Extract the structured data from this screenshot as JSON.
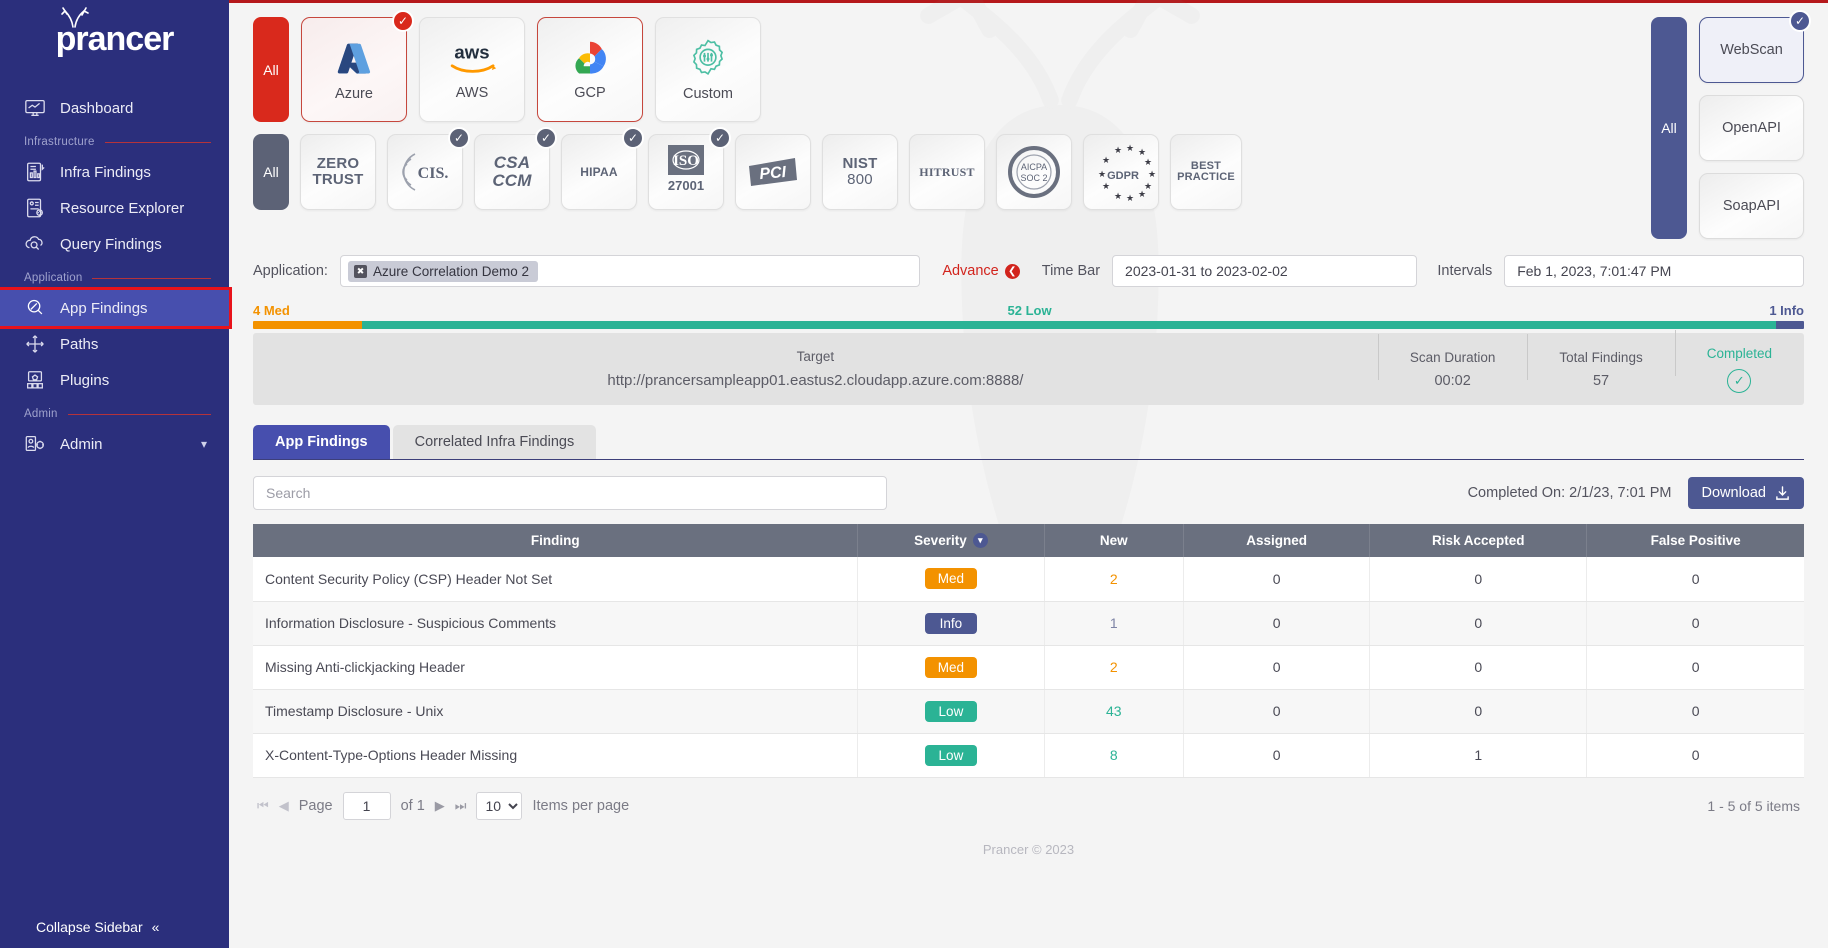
{
  "sidebar": {
    "brand": "prancer",
    "items": [
      {
        "label": "Dashboard",
        "icon": "dashboard-icon",
        "type": "item"
      },
      {
        "label": "Infrastructure",
        "type": "section"
      },
      {
        "label": "Infra Findings",
        "icon": "infra-findings-icon",
        "type": "item"
      },
      {
        "label": "Resource Explorer",
        "icon": "resource-explorer-icon",
        "type": "item"
      },
      {
        "label": "Query Findings",
        "icon": "query-findings-icon",
        "type": "item"
      },
      {
        "label": "Application",
        "type": "section"
      },
      {
        "label": "App Findings",
        "icon": "app-findings-icon",
        "type": "item",
        "active": true
      },
      {
        "label": "Paths",
        "icon": "paths-icon",
        "type": "item"
      },
      {
        "label": "Plugins",
        "icon": "plugins-icon",
        "type": "item"
      },
      {
        "label": "Admin",
        "type": "section"
      },
      {
        "label": "Admin",
        "icon": "admin-icon",
        "type": "item",
        "chevron": "chevron-down-icon"
      }
    ],
    "collapse_label": "Collapse Sidebar",
    "collapse_icon": "double-chevron-left-icon"
  },
  "providers": {
    "all_label": "All",
    "cards": [
      {
        "label": "Azure",
        "icon": "azure-logo",
        "selected": true,
        "checked": true
      },
      {
        "label": "AWS",
        "icon": "aws-logo",
        "selected": false,
        "checked": false
      },
      {
        "label": "GCP",
        "icon": "gcp-logo",
        "selected": true,
        "checked": false
      },
      {
        "label": "Custom",
        "icon": "custom-gear-icon",
        "selected": false,
        "checked": false
      }
    ]
  },
  "standards": {
    "all_label": "All",
    "cards": [
      {
        "label": "ZERO TRUST",
        "icon": "zero-trust-logo",
        "checked": false
      },
      {
        "label": "CIS.",
        "icon": "cis-logo",
        "checked": true
      },
      {
        "label": "CSA CCM",
        "icon": "csa-ccm-logo",
        "checked": true
      },
      {
        "label": "HIPAA",
        "icon": "hipaa-logo",
        "checked": true
      },
      {
        "label": "ISO 27001",
        "icon": "iso-27001-logo",
        "checked": true
      },
      {
        "label": "PCI",
        "icon": "pci-logo",
        "checked": false
      },
      {
        "label": "NIST 800",
        "icon": "nist-800-logo",
        "checked": false
      },
      {
        "label": "HITRUST",
        "icon": "hitrust-logo",
        "checked": false
      },
      {
        "label": "AICPA SOC 2",
        "icon": "aicpa-soc2-logo",
        "checked": false
      },
      {
        "label": "GDPR",
        "icon": "gdpr-logo",
        "checked": false
      },
      {
        "label": "BEST PRACTICE",
        "icon": "best-practice-logo",
        "checked": false
      }
    ]
  },
  "scan_types": {
    "all_label": "All",
    "cards": [
      {
        "label": "WebScan",
        "selected": true,
        "checked": true
      },
      {
        "label": "OpenAPI",
        "selected": false,
        "checked": false
      },
      {
        "label": "SoapAPI",
        "selected": false,
        "checked": false
      }
    ]
  },
  "filters": {
    "application_label": "Application:",
    "application_chip": "Azure Correlation Demo 2",
    "advance_label": "Advance",
    "time_bar_label": "Time Bar",
    "time_bar_value": "2023-01-31 to 2023-02-02",
    "intervals_label": "Intervals",
    "intervals_value": "Feb 1, 2023, 7:01:47 PM"
  },
  "severity_bar": {
    "segments": [
      {
        "label": "4 Med",
        "count": 4,
        "color": "#f39200",
        "percent": 7.0
      },
      {
        "label": "52 Low",
        "count": 52,
        "color": "#2bb395",
        "percent": 91.2
      },
      {
        "label": "1 Info",
        "count": 1,
        "color": "#4d5892",
        "percent": 1.8
      }
    ]
  },
  "summary": {
    "target_label": "Target",
    "target_value": "http://prancersampleapp01.eastus2.cloudapp.azure.com:8888/",
    "scan_duration_label": "Scan Duration",
    "scan_duration_value": "00:02",
    "total_findings_label": "Total Findings",
    "total_findings_value": "57",
    "status_label": "Completed",
    "status_icon": "check-circle-icon"
  },
  "tabs": [
    {
      "label": "App Findings",
      "active": true
    },
    {
      "label": "Correlated Infra Findings",
      "active": false
    }
  ],
  "toolbar": {
    "search_placeholder": "Search",
    "search_value": "",
    "completed_on": "Completed On: 2/1/23, 7:01 PM",
    "download_label": "Download",
    "download_icon": "download-icon"
  },
  "table": {
    "columns": [
      "Finding",
      "Severity",
      "New",
      "Assigned",
      "Risk Accepted",
      "False Positive"
    ],
    "sort_column": "Severity",
    "sort_icon": "chevron-down-icon",
    "rows": [
      {
        "finding": "Content Security Policy (CSP) Header Not Set",
        "severity": "Med",
        "severity_class": "med",
        "new": "2",
        "assigned": "0",
        "risk_accepted": "0",
        "false_positive": "0"
      },
      {
        "finding": "Information Disclosure - Suspicious Comments",
        "severity": "Info",
        "severity_class": "info",
        "new": "1",
        "assigned": "0",
        "risk_accepted": "0",
        "false_positive": "0"
      },
      {
        "finding": "Missing Anti-clickjacking Header",
        "severity": "Med",
        "severity_class": "med",
        "new": "2",
        "assigned": "0",
        "risk_accepted": "0",
        "false_positive": "0"
      },
      {
        "finding": "Timestamp Disclosure - Unix",
        "severity": "Low",
        "severity_class": "low",
        "new": "43",
        "assigned": "0",
        "risk_accepted": "0",
        "false_positive": "0"
      },
      {
        "finding": "X-Content-Type-Options Header Missing",
        "severity": "Low",
        "severity_class": "low",
        "new": "8",
        "assigned": "0",
        "risk_accepted": "1",
        "false_positive": "0"
      }
    ]
  },
  "pagination": {
    "first_icon": "first-page-icon",
    "prev_icon": "prev-page-icon",
    "page_label": "Page",
    "page_value": "1",
    "of_label": "of 1",
    "next_icon": "next-page-icon",
    "last_icon": "last-page-icon",
    "items_per_page_value": "10",
    "items_per_page_label": "Items per page",
    "range_label": "1 - 5 of 5 items"
  },
  "footer": {
    "copyright": "Prancer © 2023"
  }
}
